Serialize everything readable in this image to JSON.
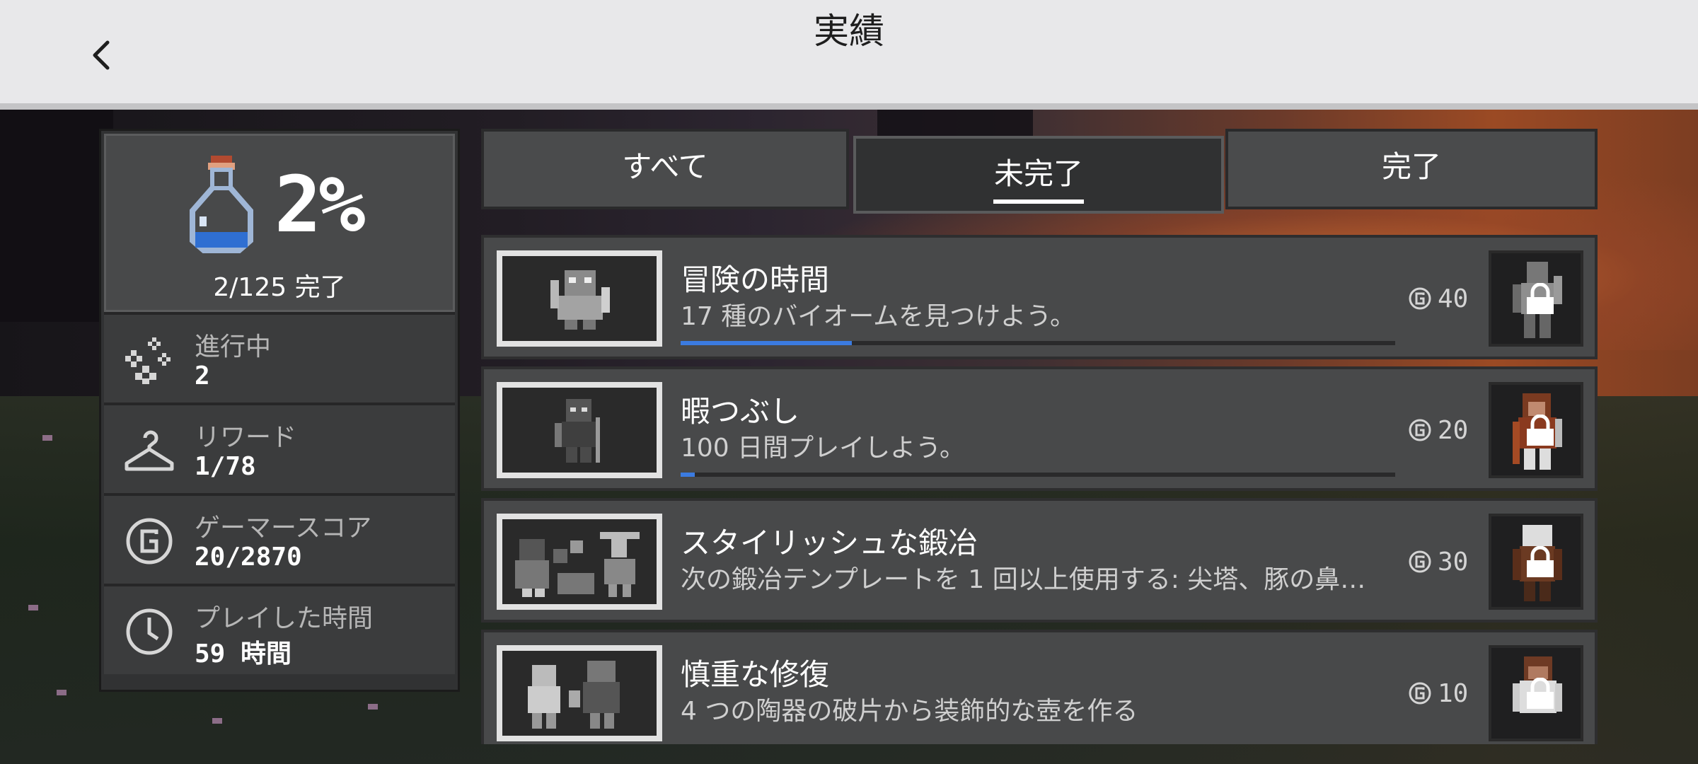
{
  "header": {
    "title": "実績",
    "back_icon": "chevron-left-icon"
  },
  "summary": {
    "percent": "2%",
    "progress_text": "2/125 完了",
    "icon": "potion-bottle-icon"
  },
  "stats": [
    {
      "icon": "sparkles-icon",
      "label": "進行中",
      "value": "2"
    },
    {
      "icon": "hanger-icon",
      "label": "リワード",
      "value": "1/78"
    },
    {
      "icon": "gamerscore-icon",
      "label": "ゲーマースコア",
      "value": "20/2870"
    },
    {
      "icon": "clock-icon",
      "label": "プレイした時間",
      "value": "59 時間"
    }
  ],
  "tabs": [
    {
      "label": "すべて",
      "selected": false
    },
    {
      "label": "未完了",
      "selected": true
    },
    {
      "label": "完了",
      "selected": false
    }
  ],
  "achievements": [
    {
      "title": "冒険の時間",
      "description": "17 種のバイオームを見つけよう。",
      "score": "40",
      "progress": 0.24,
      "locked": true
    },
    {
      "title": "暇つぶし",
      "description": "100 日間プレイしよう。",
      "score": "20",
      "progress": 0.02,
      "locked": true
    },
    {
      "title": "スタイリッシュな鍛冶",
      "description": "次の鍛冶テンプレートを 1 回以上使用する: 尖塔、豚の鼻…",
      "score": "30",
      "progress": null,
      "locked": true
    },
    {
      "title": "慎重な修復",
      "description": "4 つの陶器の破片から装飾的な壺を作る",
      "score": "10",
      "progress": null,
      "locked": true
    }
  ],
  "colors": {
    "progress_fill": "#3b7be0",
    "panel_dark": "#313233",
    "panel_mid": "#48494a",
    "header_bg": "#e8e8ea"
  }
}
